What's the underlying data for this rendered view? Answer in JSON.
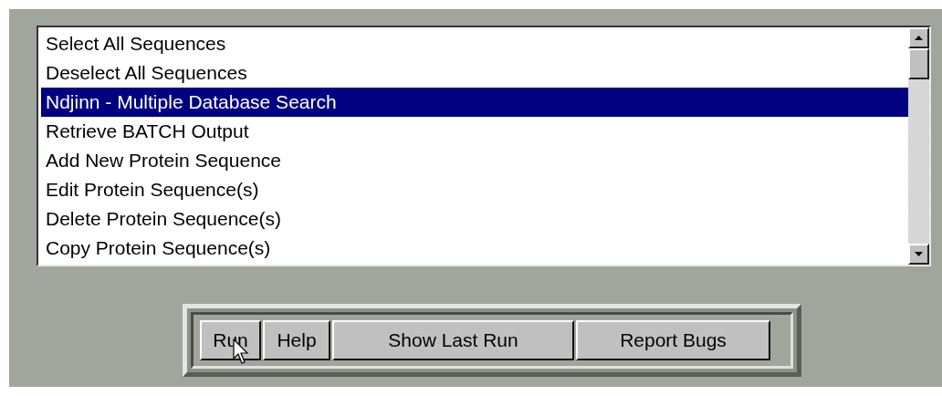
{
  "list": {
    "items": [
      {
        "label": "Select All Sequences",
        "selected": false
      },
      {
        "label": "Deselect All Sequences",
        "selected": false
      },
      {
        "label": "Ndjinn - Multiple Database Search",
        "selected": true
      },
      {
        "label": "Retrieve BATCH Output",
        "selected": false
      },
      {
        "label": "Add New Protein Sequence",
        "selected": false
      },
      {
        "label": "Edit Protein Sequence(s)",
        "selected": false
      },
      {
        "label": "Delete Protein Sequence(s)",
        "selected": false
      },
      {
        "label": "Copy Protein Sequence(s)",
        "selected": false
      }
    ]
  },
  "buttons": [
    {
      "label": "Run"
    },
    {
      "label": "Help"
    },
    {
      "label": "Show Last Run"
    },
    {
      "label": "Report Bugs"
    }
  ]
}
